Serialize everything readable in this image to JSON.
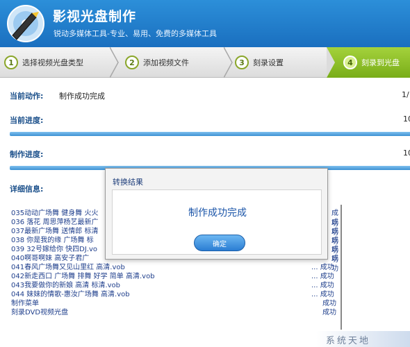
{
  "header": {
    "title": "影视光盘制作",
    "subtitle": "锐动多媒体工具-专业、易用、免费的多媒体工具"
  },
  "steps": [
    {
      "num": "1",
      "label": "选择视频光盘类型",
      "active": false
    },
    {
      "num": "2",
      "label": "添加视频文件",
      "active": false
    },
    {
      "num": "3",
      "label": "刻录设置",
      "active": false
    },
    {
      "num": "4",
      "label": "刻录到光盘",
      "active": true
    }
  ],
  "status": {
    "current_action_label": "当前动作:",
    "current_action_value": "制作成功完成",
    "current_action_count": "1/",
    "current_progress_label": "当前进度:",
    "current_progress_value": "10",
    "make_progress_label": "制作进度:",
    "make_progress_value": "10",
    "current_progress_fraction": 1.0,
    "make_progress_fraction": 1.0,
    "details_label": "详细信息:"
  },
  "log": [
    {
      "text": "035动动广场舞 健身舞 火火",
      "status": "成功"
    },
    {
      "text": "036 落花 周思萍杨艺最新广",
      "status": "成功"
    },
    {
      "text": "037最新广场舞 送情郎 标清",
      "status": "成功"
    },
    {
      "text": "038 你是我的缘  广场舞 标",
      "status": "成功"
    },
    {
      "text": "039  32号嫁给你  快四DJ.vo",
      "status": "成功"
    },
    {
      "text": "040啊哥啊妹      高安子君广",
      "status": "成功"
    },
    {
      "text": "041春风广场舞又见山里红 高清.vob",
      "status": "... 成功"
    },
    {
      "text": "042新走西口  广场舞 排舞 好学  简单 高清.vob",
      "status": "... 成功"
    },
    {
      "text": "043我要做你的新娘 高清 标清.vob",
      "status": "... 成功"
    },
    {
      "text": "044 妹妹的情歌-惠汝广场舞 高清.vob",
      "status": "... 成功"
    },
    {
      "text": "制作菜单",
      "status": "成功"
    },
    {
      "text": "刻录DVD视频光盘",
      "status": "成功"
    }
  ],
  "dialog": {
    "title": "转换结果",
    "message": "制作成功完成",
    "ok_button": "确定"
  },
  "watermark": "系统天地"
}
